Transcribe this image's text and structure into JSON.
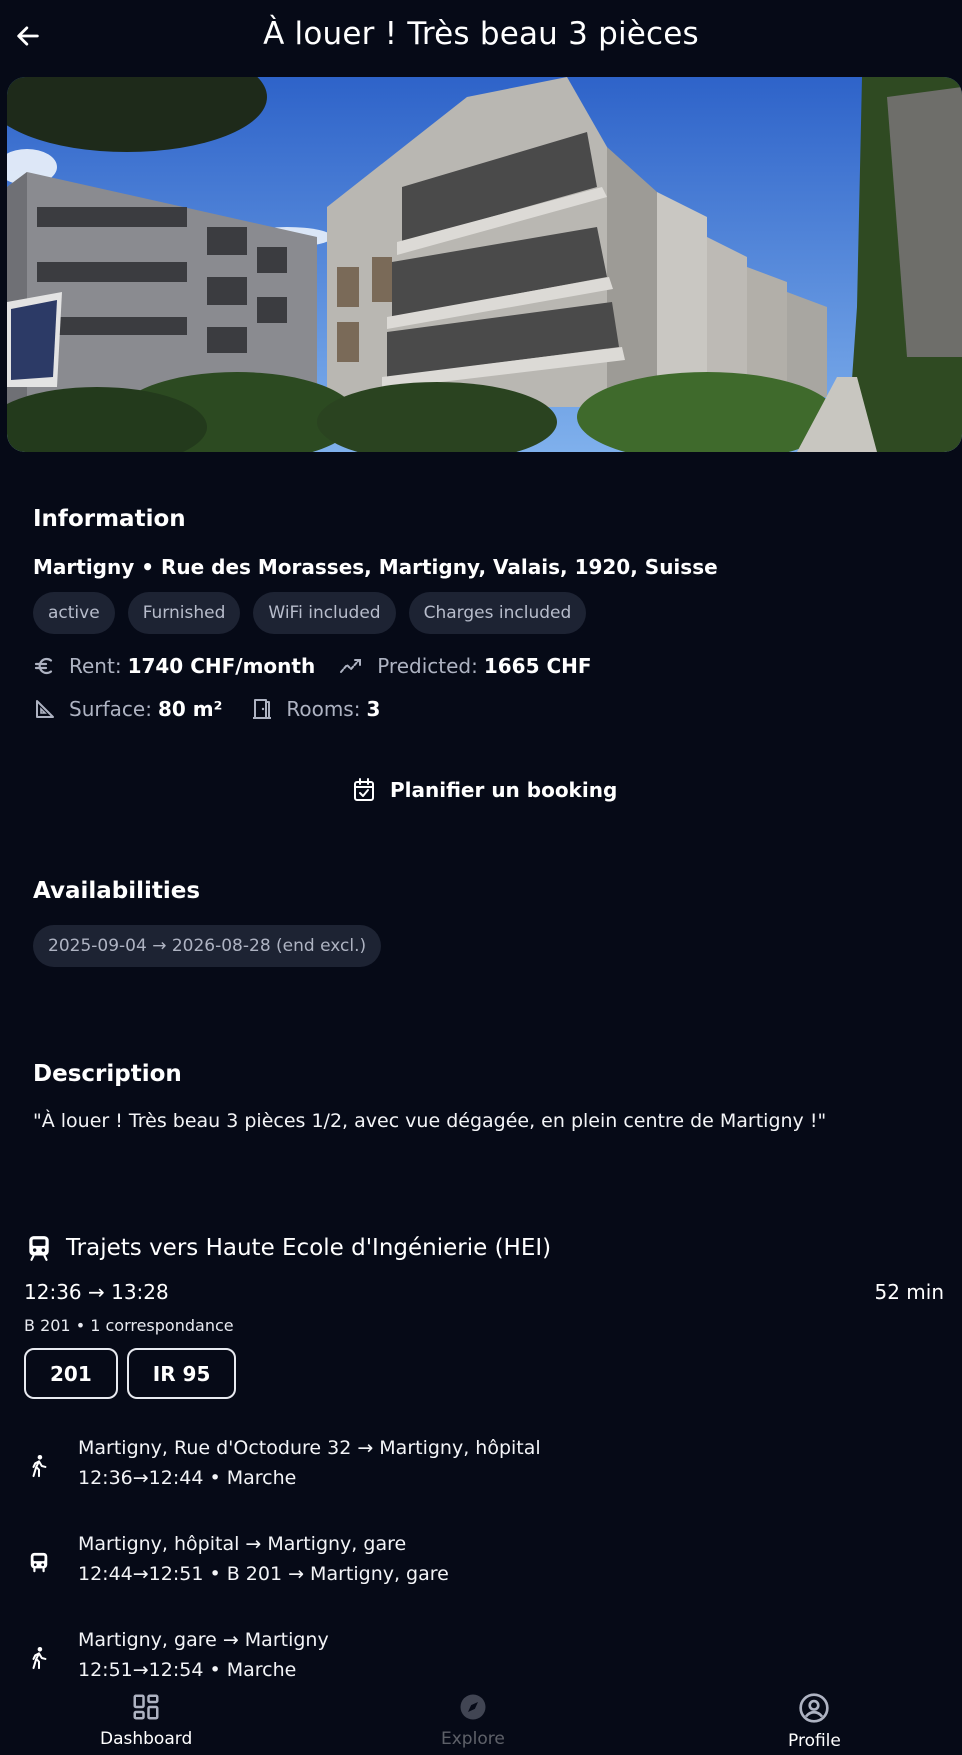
{
  "header": {
    "title": "À louer ! Très beau 3 pièces",
    "back_icon": "arrow-left-icon"
  },
  "information": {
    "title": "Information",
    "address": "Martigny • Rue des Morasses, Martigny, Valais, 1920, Suisse",
    "tags": [
      "active",
      "Furnished",
      "WiFi included",
      "Charges included"
    ],
    "rent_label": "Rent:",
    "rent_value": "1740 CHF/month",
    "predicted_label": "Predicted:",
    "predicted_value": "1665 CHF",
    "surface_label": "Surface:",
    "surface_value": "80 m²",
    "rooms_label": "Rooms:",
    "rooms_value": "3",
    "booking_button": "Planifier un booking"
  },
  "availabilities": {
    "title": "Availabilities",
    "ranges": [
      "2025-09-04 → 2026-08-28 (end excl.)"
    ]
  },
  "description": {
    "title": "Description",
    "text": "\"À louer ! Très beau 3 pièces 1/2, avec vue dégagée, en plein centre de Martigny !\""
  },
  "trajets": {
    "title": "Trajets vers Haute Ecole d'Ingénierie (HEI)",
    "times": "12:36 → 13:28",
    "duration": "52 min",
    "summary": "B 201 • 1 correspondance",
    "lines": [
      "201",
      "IR 95"
    ],
    "steps": [
      {
        "icon": "walk-icon",
        "route": "Martigny, Rue d'Octodure 32 → Martigny, hôpital",
        "detail": "12:36→12:44 • Marche"
      },
      {
        "icon": "bus-icon",
        "route": "Martigny, hôpital → Martigny, gare",
        "detail": "12:44→12:51 • B 201 → Martigny, gare"
      },
      {
        "icon": "walk-icon",
        "route": "Martigny, gare → Martigny",
        "detail": "12:51→12:54 • Marche"
      }
    ]
  },
  "nav": {
    "dashboard": "Dashboard",
    "explore": "Explore",
    "profile": "Profile"
  },
  "colors": {
    "background": "#060a17",
    "chip_bg": "#1d2333",
    "chip_text": "#b7bccb",
    "muted_text": "#aeb3c2"
  }
}
